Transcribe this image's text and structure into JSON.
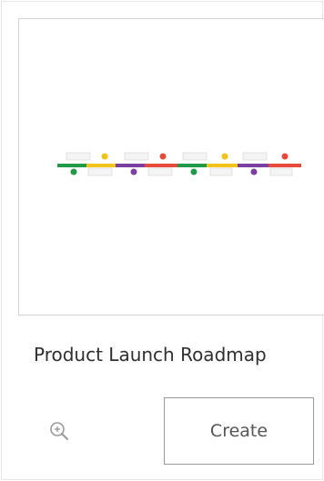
{
  "template": {
    "title": "Product Launch Roadmap",
    "create_label": "Create",
    "zoom_icon": "zoom-in-icon",
    "preview_icon": "timeline-roadmap-thumbnail"
  },
  "colors": {
    "green": "#1f9a49",
    "yellow": "#f2c318",
    "purple": "#7b3fa3",
    "red": "#e64a3b",
    "border": "#d4d4d4",
    "button_border": "#9a9a9a",
    "text": "#2f2f2f"
  }
}
